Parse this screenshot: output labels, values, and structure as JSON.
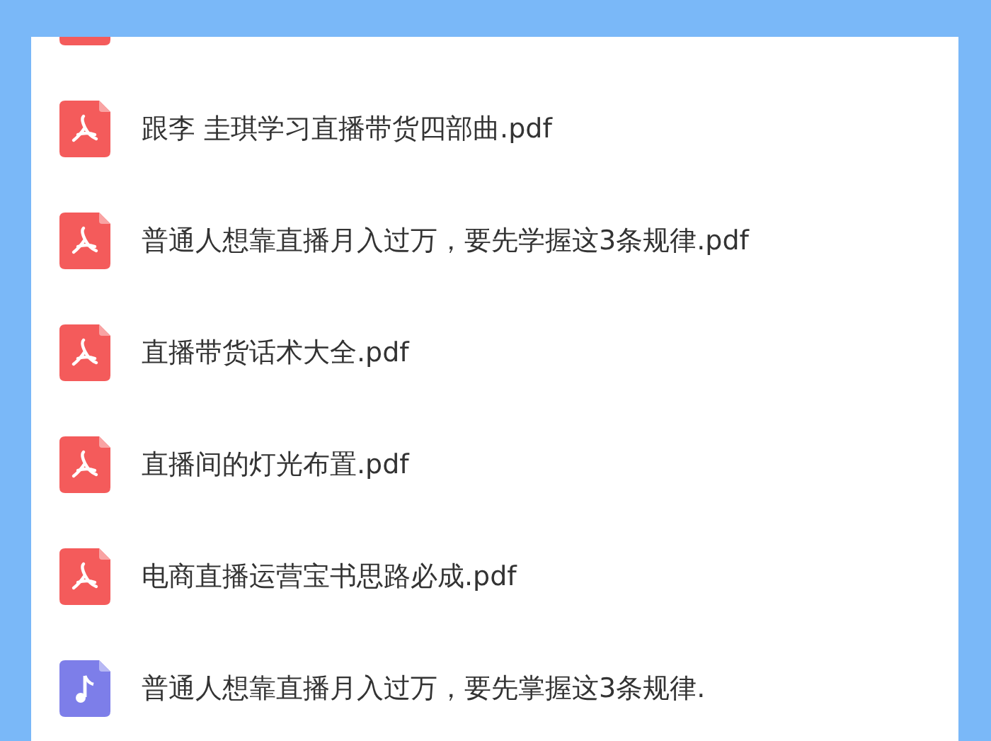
{
  "files": [
    {
      "kind": "pdf"
    },
    {
      "kind": "pdf",
      "name": "跟李 圭琪学习直播带货四部曲.pdf"
    },
    {
      "kind": "pdf",
      "name": "普通人想靠直播月入过万，要先学握这3条规律.pdf"
    },
    {
      "kind": "pdf",
      "name": "直播带货话术大全.pdf"
    },
    {
      "kind": "pdf",
      "name": "直播间的灯光布置.pdf"
    },
    {
      "kind": "pdf",
      "name": "电商直播运营宝书思路必成.pdf"
    },
    {
      "kind": "audio",
      "name": "普通人想靠直播月入过万，要先掌握这3条规律."
    }
  ]
}
